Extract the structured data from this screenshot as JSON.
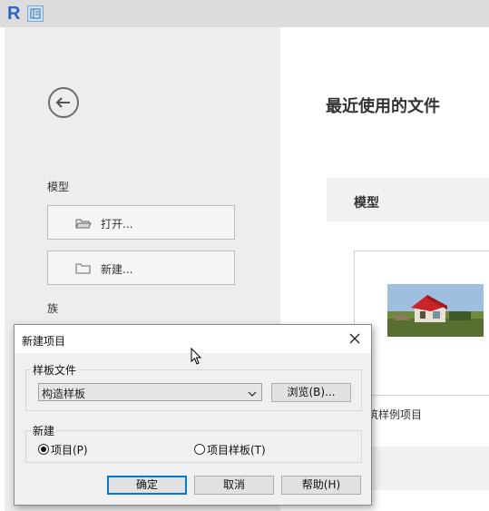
{
  "app": {
    "logo_letter": "R"
  },
  "sidebar": {
    "model_label": "模型",
    "open_label": "打开...",
    "new_label": "新建...",
    "family_label": "族"
  },
  "main": {
    "recent_title": "最近使用的文件",
    "section_label": "模型",
    "card_caption": "筑样例项目"
  },
  "dialog": {
    "title": "新建项目",
    "template_group": "样板文件",
    "template_value": "构造样板",
    "browse_label": "浏览(B)...",
    "create_group": "新建",
    "option_project": "项目(P)",
    "option_template": "项目样板(T)",
    "selected_option": "project",
    "ok_label": "确定",
    "cancel_label": "取消",
    "help_label": "帮助(H)"
  },
  "colors": {
    "accent": "#2c64c8",
    "default_button_border": "#0078d7",
    "sidebar_bg": "#ededed"
  }
}
